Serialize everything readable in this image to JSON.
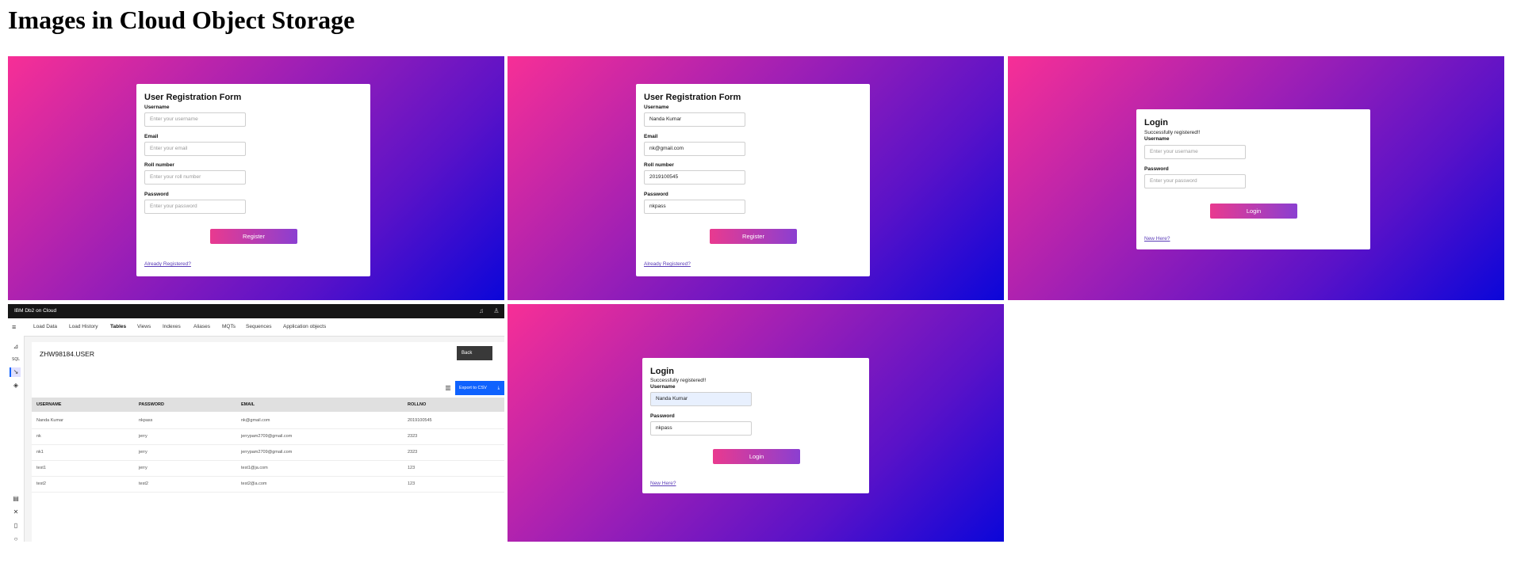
{
  "page_title": "Images in Cloud Object Storage",
  "colors": {
    "gradient_start": "#f72f96",
    "gradient_end": "#0b06d9",
    "button_start": "#e93a8f",
    "button_end": "#8b3fd1",
    "ibm_blue": "#0f62fe"
  },
  "register_empty": {
    "title": "User Registration Form",
    "username_label": "Username",
    "username_placeholder": "Enter your username",
    "email_label": "Email",
    "email_placeholder": "Enter your email",
    "roll_label": "Roll number",
    "roll_placeholder": "Enter your roll number",
    "password_label": "Password",
    "password_placeholder": "Enter your password",
    "submit": "Register",
    "link": "Already Registered?"
  },
  "register_filled": {
    "title": "User Registration Form",
    "username_label": "Username",
    "username_value": "Nanda Kumar",
    "email_label": "Email",
    "email_value": "nk@gmail.com",
    "roll_label": "Roll number",
    "roll_value": "2019100545",
    "password_label": "Password",
    "password_value": "nkpass",
    "submit": "Register",
    "link": "Already Registered?"
  },
  "login_empty": {
    "title": "Login",
    "status": "Successfully registered!!",
    "username_label": "Username",
    "username_placeholder": "Enter your username",
    "password_label": "Password",
    "password_placeholder": "Enter your password",
    "submit": "Login",
    "link": "New Here?"
  },
  "login_filled": {
    "title": "Login",
    "status": "Successfully registered!!",
    "username_label": "Username",
    "username_value": "Nanda Kumar",
    "password_label": "Password",
    "password_value": "nkpass",
    "submit": "Login",
    "link": "New Here?"
  },
  "db2": {
    "brand": "IBM Db2 on Cloud",
    "nav": [
      "Load Data",
      "Load History",
      "Tables",
      "Views",
      "Indexes",
      "Aliases",
      "MQTs",
      "Sequences",
      "Application objects"
    ],
    "active_nav": "Tables",
    "icons": {
      "bell": "bell-icon",
      "user": "user-icon",
      "menu": "menu-icon",
      "chart": "chart-icon",
      "sql": "SQL",
      "explore": "explore-icon",
      "tag": "tag-icon",
      "trash": "trash-icon",
      "download": "download-icon"
    },
    "table_name": "ZHW98184.USER",
    "back_label": "Back",
    "export_label": "Export to CSV",
    "columns": [
      "USERNAME",
      "PASSWORD",
      "EMAIL",
      "ROLLNO"
    ],
    "rows": [
      [
        "Nanda Kumar",
        "nkpass",
        "nk@gmail.com",
        "2019100545"
      ],
      [
        "nk",
        "jerry",
        "jerrypam2709@gmail.com",
        "2323"
      ],
      [
        "nk1",
        "jerry",
        "jerrypam2709@gmail.com",
        "2323"
      ],
      [
        "test1",
        "jerry",
        "test1@ja.com",
        "123"
      ],
      [
        "test2",
        "test2",
        "test2@a.com",
        "123"
      ]
    ]
  }
}
